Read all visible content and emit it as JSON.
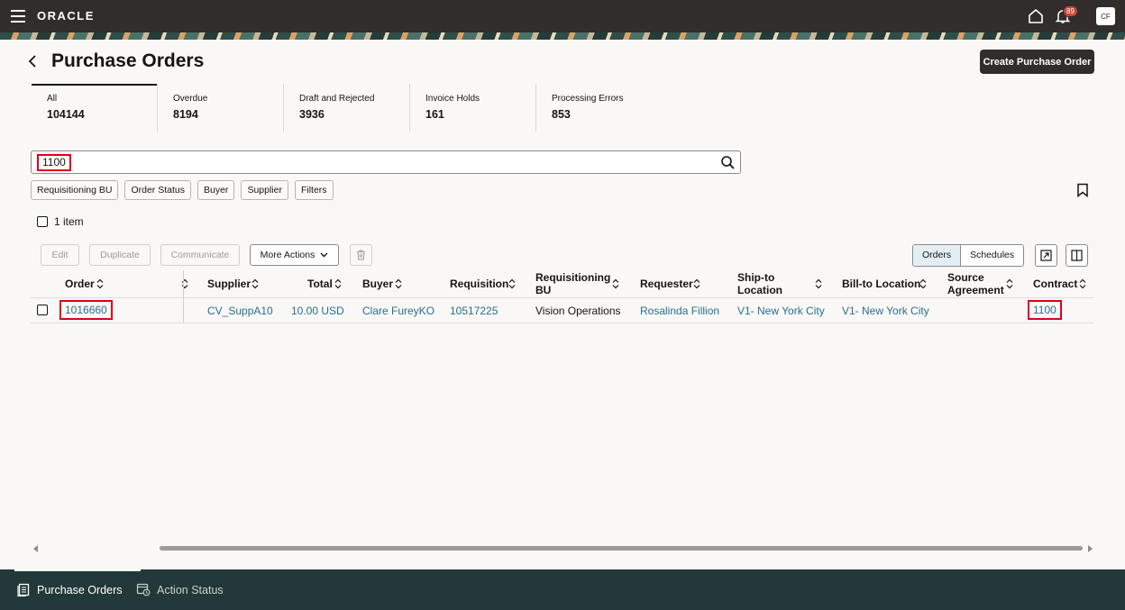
{
  "header": {
    "logo": "ORACLE",
    "notification_count": "89",
    "avatar_initials": "CF"
  },
  "page": {
    "title": "Purchase Orders",
    "create_button": "Create Purchase Order"
  },
  "tiles": [
    {
      "label": "All",
      "value": "104144"
    },
    {
      "label": "Overdue",
      "value": "8194"
    },
    {
      "label": "Draft and Rejected",
      "value": "3936"
    },
    {
      "label": "Invoice Holds",
      "value": "161"
    },
    {
      "label": "Processing Errors",
      "value": "853"
    }
  ],
  "search": {
    "keyword": "1100"
  },
  "filters": [
    "Requisitioning BU",
    "Order Status",
    "Buyer",
    "Supplier",
    "Filters"
  ],
  "selection": {
    "count_label": "1 item"
  },
  "toolbar": {
    "edit": "Edit",
    "duplicate": "Duplicate",
    "communicate": "Communicate",
    "more_actions": "More Actions",
    "view_orders": "Orders",
    "view_schedules": "Schedules"
  },
  "table": {
    "columns": {
      "order": "Order",
      "supplier": "Supplier",
      "total": "Total",
      "buyer": "Buyer",
      "requisition": "Requisition",
      "req_bu_1": "Requisitioning",
      "req_bu_2": "BU",
      "requester": "Requester",
      "ship_1": "Ship-to",
      "ship_2": "Location",
      "bill_to": "Bill-to Location",
      "source_1": "Source",
      "source_2": "Agreement",
      "contract": "Contract"
    },
    "rows": [
      {
        "order": "1016660",
        "supplier": "CV_SuppA10",
        "total": "10.00 USD",
        "buyer": "Clare FureyKO",
        "requisition": "10517225",
        "req_bu": "Vision Operations",
        "requester": "Rosalinda Fillion",
        "ship_to": "V1- New York City",
        "bill_to": "V1- New York City",
        "source_agreement": "",
        "contract": "1100"
      }
    ]
  },
  "bottom_tabs": [
    "Purchase Orders",
    "Action Status"
  ]
}
